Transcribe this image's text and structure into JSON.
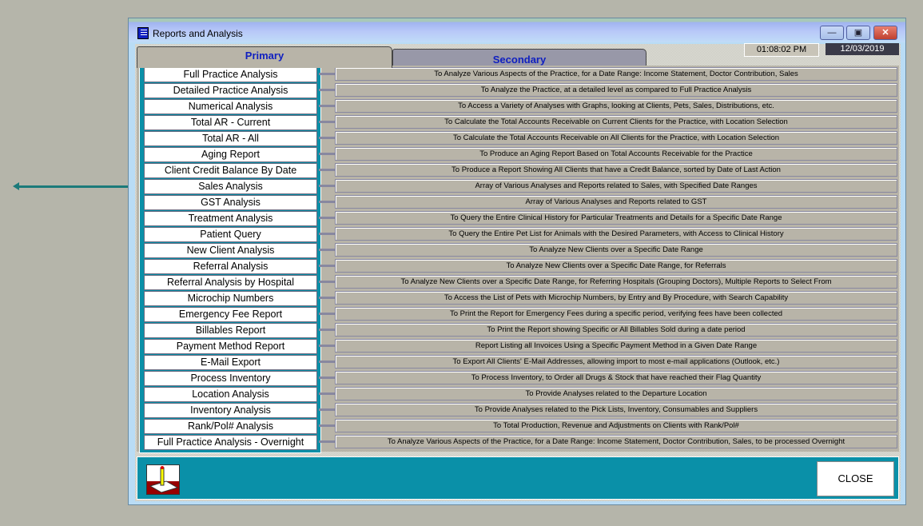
{
  "window": {
    "title": "Reports and Analysis",
    "time": "01:08:02 PM",
    "date": "12/03/2019",
    "close_label": "CLOSE"
  },
  "tabs": [
    {
      "label": "Primary",
      "active": true
    },
    {
      "label": "Secondary",
      "active": false
    }
  ],
  "colors": {
    "accent": "#0a90a8",
    "tab_text": "#1020c0",
    "arrow": "#1b7a7a"
  },
  "reports": [
    {
      "label": "Full Practice Analysis",
      "desc": "To Analyze Various Aspects of the Practice, for a Date Range: Income Statement, Doctor Contribution, Sales"
    },
    {
      "label": "Detailed Practice Analysis",
      "desc": "To Analyze the Practice, at a detailed level as compared to Full Practice Analysis"
    },
    {
      "label": "Numerical Analysis",
      "desc": "To Access a Variety of Analyses with Graphs, looking at Clients, Pets, Sales, Distributions, etc."
    },
    {
      "label": "Total AR - Current",
      "desc": "To Calculate the Total Accounts Receivable on Current Clients for the Practice, with Location Selection"
    },
    {
      "label": "Total AR - All",
      "desc": "To Calculate the Total Accounts Receivable on All Clients for the Practice, with Location Selection"
    },
    {
      "label": "Aging Report",
      "desc": "To Produce an Aging Report Based on Total Accounts Receivable for the Practice"
    },
    {
      "label": "Client Credit Balance By Date",
      "desc": "To Produce a Report Showing All Clients that have a Credit Balance, sorted by Date of Last Action"
    },
    {
      "label": "Sales Analysis",
      "desc": "Array of Various Analyses and Reports related to Sales, with Specified Date Ranges"
    },
    {
      "label": "GST Analysis",
      "desc": "Array of Various Analyses and Reports related to GST"
    },
    {
      "label": "Treatment Analysis",
      "desc": "To Query the Entire Clinical History for Particular Treatments and Details for a Specific Date Range"
    },
    {
      "label": "Patient Query",
      "desc": "To Query the Entire Pet List for Animals with the Desired Parameters, with Access to Clinical History"
    },
    {
      "label": "New Client Analysis",
      "desc": "To Analyze New Clients over a Specific Date Range"
    },
    {
      "label": "Referral Analysis",
      "desc": "To Analyze New Clients over a Specific Date Range, for Referrals"
    },
    {
      "label": "Referral Analysis by Hospital",
      "desc": "To Analyze New Clients over a Specific Date Range, for Referring Hospitals (Grouping Doctors), Multiple Reports to Select From"
    },
    {
      "label": "Microchip Numbers",
      "desc": "To Access the List of Pets with Microchip Numbers, by Entry and By Procedure, with Search Capability"
    },
    {
      "label": "Emergency Fee Report",
      "desc": "To Print the Report for Emergency Fees during a specific period, verifying fees have been collected"
    },
    {
      "label": "Billables Report",
      "desc": "To Print the Report showing Specific or All Billables Sold during a date period"
    },
    {
      "label": "Payment Method Report",
      "desc": "Report Listing all Invoices Using a Specific Payment Method in a Given Date Range"
    },
    {
      "label": "E-Mail Export",
      "desc": "To Export All Clients' E-Mail Addresses, allowing import to most e-mail applications (Outlook, etc.)"
    },
    {
      "label": "Process Inventory",
      "desc": "To Process Inventory, to Order all Drugs & Stock that have reached their Flag Quantity"
    },
    {
      "label": "Location Analysis",
      "desc": "To Provide Analyses related to the Departure Location"
    },
    {
      "label": "Inventory Analysis",
      "desc": "To Provide Analyses related to the Pick Lists, Inventory, Consumables and Suppliers"
    },
    {
      "label": "Rank/Pol# Analysis",
      "desc": "To Total Production, Revenue and Adjustments on Clients with Rank/Pol#"
    },
    {
      "label": "Full Practice Analysis - Overnight",
      "desc": "To Analyze Various Aspects of the Practice, for a Date Range: Income Statement, Doctor Contribution, Sales, to be processed Overnight"
    }
  ]
}
